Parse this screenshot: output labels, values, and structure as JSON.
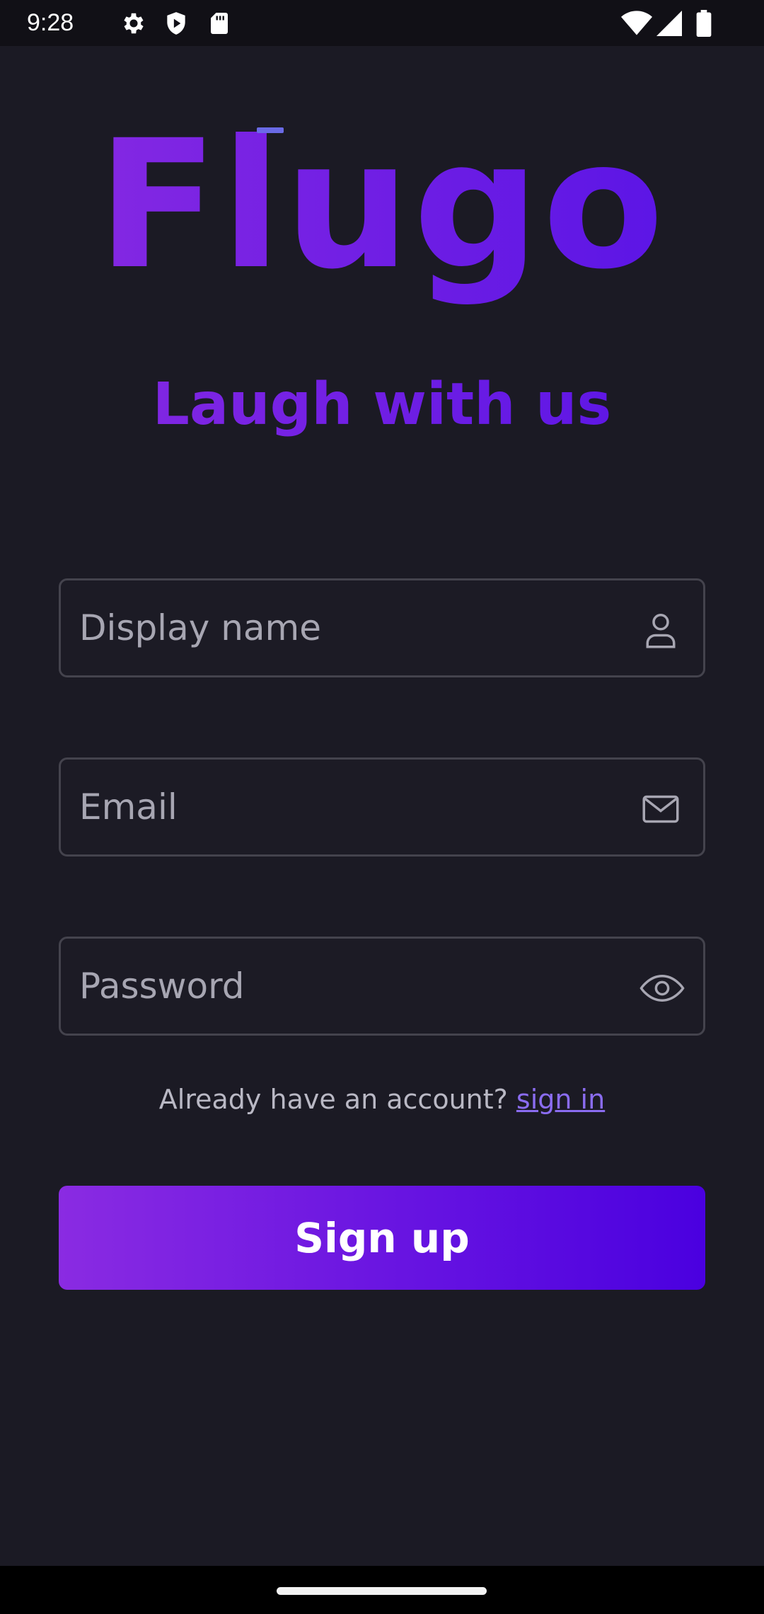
{
  "status_bar": {
    "time": "9:28",
    "left_icons": [
      "settings-icon",
      "shield-play-icon",
      "sd-card-icon"
    ],
    "right_icons": [
      "wifi-icon",
      "cell-signal-icon",
      "battery-icon"
    ]
  },
  "brand": {
    "logo": "Flugo",
    "tagline": "Laugh with us",
    "gradient_start": "#8a2be2",
    "gradient_end": "#4a00e0"
  },
  "form": {
    "display_name": {
      "placeholder": "Display name",
      "value": "",
      "icon": "person-icon"
    },
    "email": {
      "placeholder": "Email",
      "value": "",
      "icon": "mail-icon"
    },
    "password": {
      "placeholder": "Password",
      "value": "",
      "icon": "eye-icon"
    }
  },
  "signin_prompt": {
    "text": "Already have an account?",
    "link": "sign in"
  },
  "signup_button": {
    "label": "Sign up"
  }
}
